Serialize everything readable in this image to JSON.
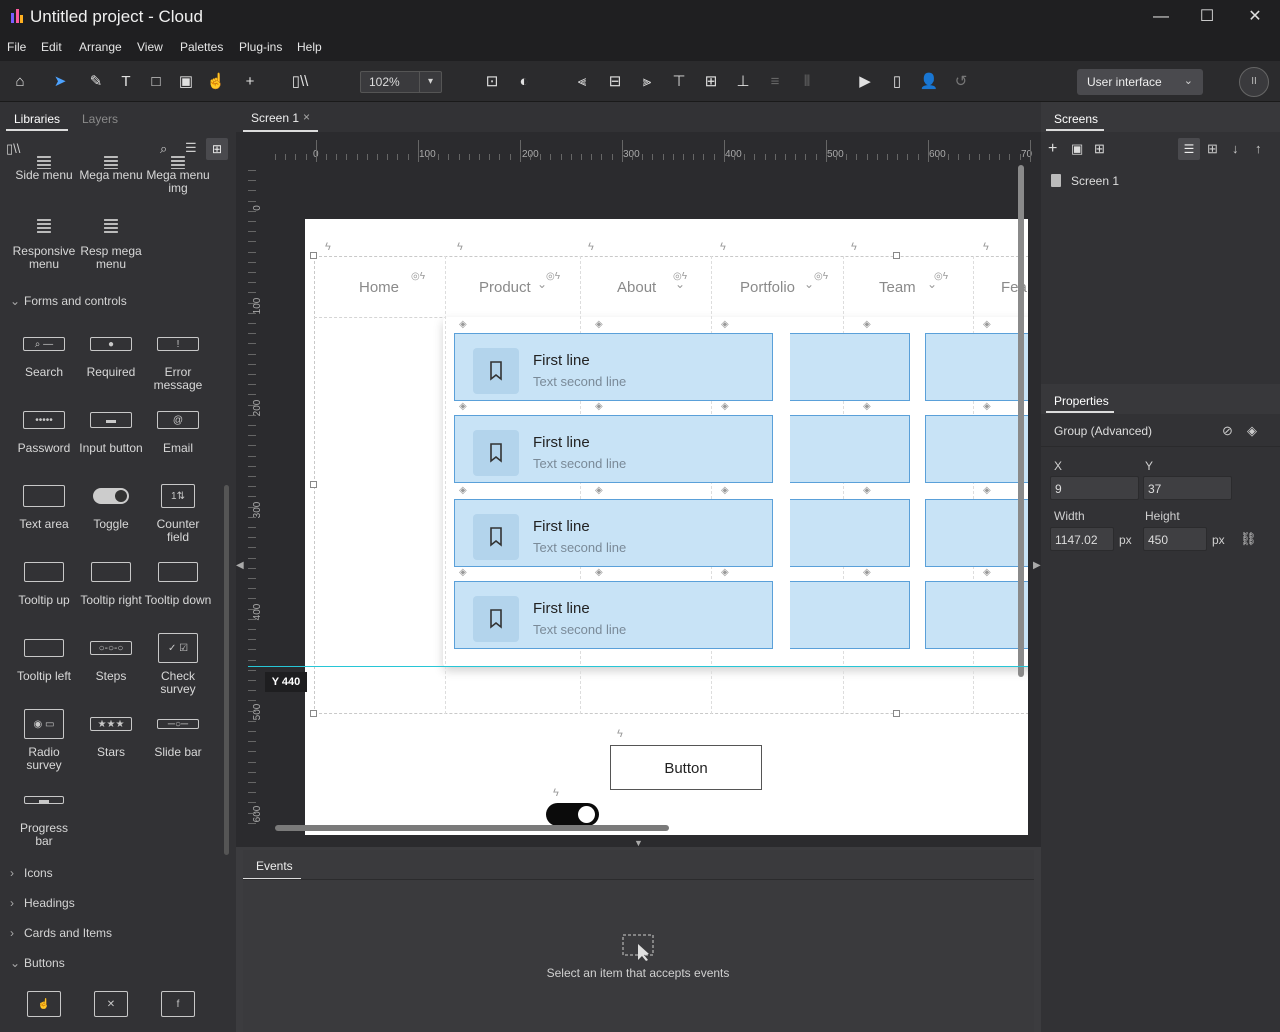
{
  "window": {
    "title": "Untitled project - Cloud",
    "minimize": "—",
    "maximize": "☐",
    "close": "✕"
  },
  "menu": [
    "File",
    "Edit",
    "Arrange",
    "View",
    "Palettes",
    "Plug-ins",
    "Help"
  ],
  "toolbar": {
    "zoom": "102%",
    "mode": "User interface",
    "avatar_initials": "II"
  },
  "left_panel": {
    "tabs": [
      "Libraries",
      "Layers"
    ],
    "top_items": [
      {
        "label": "Side menu"
      },
      {
        "label": "Mega menu"
      },
      {
        "label": "Mega menu img"
      },
      {
        "label": "Responsive menu"
      },
      {
        "label": "Resp mega menu"
      }
    ],
    "forms_section": "Forms and controls",
    "forms_items": [
      {
        "label": "Search"
      },
      {
        "label": "Required"
      },
      {
        "label": "Error message"
      },
      {
        "label": "Password"
      },
      {
        "label": "Input button"
      },
      {
        "label": "Email"
      },
      {
        "label": "Text area"
      },
      {
        "label": "Toggle"
      },
      {
        "label": "Counter field"
      },
      {
        "label": "Tooltip up"
      },
      {
        "label": "Tooltip right"
      },
      {
        "label": "Tooltip down"
      },
      {
        "label": "Tooltip left"
      },
      {
        "label": "Steps"
      },
      {
        "label": "Check survey"
      },
      {
        "label": "Radio survey"
      },
      {
        "label": "Stars"
      },
      {
        "label": "Slide bar"
      },
      {
        "label": "Progress bar"
      }
    ],
    "sections": [
      "Icons",
      "Headings",
      "Cards and Items",
      "Buttons"
    ]
  },
  "canvas": {
    "tab": "Screen 1",
    "ruler_h": [
      "0",
      "100",
      "200",
      "300",
      "400",
      "500",
      "600",
      "70"
    ],
    "ruler_v": [
      "0",
      "100",
      "200",
      "300",
      "400",
      "500",
      "600"
    ],
    "nav": [
      "Home",
      "Product",
      "About",
      "Portfolio",
      "Team",
      "Fea"
    ],
    "card_line1": "First line",
    "card_line2": "Text second line",
    "button_label": "Button",
    "guide_label": "Y 440"
  },
  "events": {
    "tab": "Events",
    "hint": "Select an item that accepts events"
  },
  "right_panel": {
    "screens_tab": "Screens",
    "screen_item": "Screen 1",
    "properties_tab": "Properties",
    "group_type": "Group (Advanced)",
    "x_label": "X",
    "x_value": "9",
    "y_label": "Y",
    "y_value": "37",
    "width_label": "Width",
    "width_value": "1147.02",
    "height_label": "Height",
    "height_value": "450",
    "unit": "px"
  }
}
